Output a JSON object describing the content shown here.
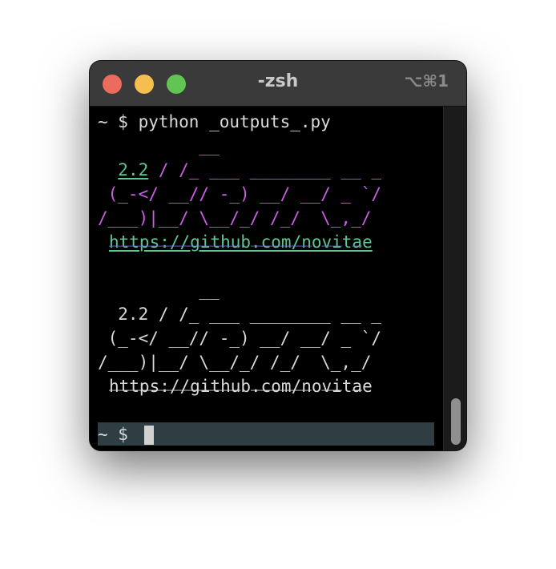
{
  "window": {
    "title": "-zsh",
    "shortcut": "⌥⌘1"
  },
  "terminal": {
    "command_line": "~ $ python _outputs_.py",
    "colored_block": {
      "l1": "          __",
      "l2_pre": "  ",
      "l2_version": "2.2",
      "l2_post": " / /_ ___ ________ __ _",
      "l3": " (_-</ __// -_) __/ __/ _ `/",
      "l4": "/___)|__/ \\__/_/ /_/  \\_,_/",
      "url": "https://github.com/novitae",
      "dashes": "‾‾‾‾‾‾‾‾‾‾‾‾‾ ‾‾‾‾‾‾ ‾‾ ‾"
    },
    "plain_block": {
      "l1": "          __",
      "l2": "  2.2 / /_ ___ ________ __ _",
      "l3": " (_-</ __// -_) __/ __/ _ `/",
      "l4": "/___)|__/ \\__/_/ /_/  \\_,_/",
      "url": "https://github.com/novitae",
      "dashes": "‾‾‾‾‾‾‾‾‾‾‾‾‾ ‾‾‾‾‾‾ ‾‾ ‾"
    },
    "prompt": "~ $"
  },
  "colors": {
    "magenta": "#cc5ee6",
    "green": "#5ec592",
    "purple": "#7b6cf0"
  }
}
